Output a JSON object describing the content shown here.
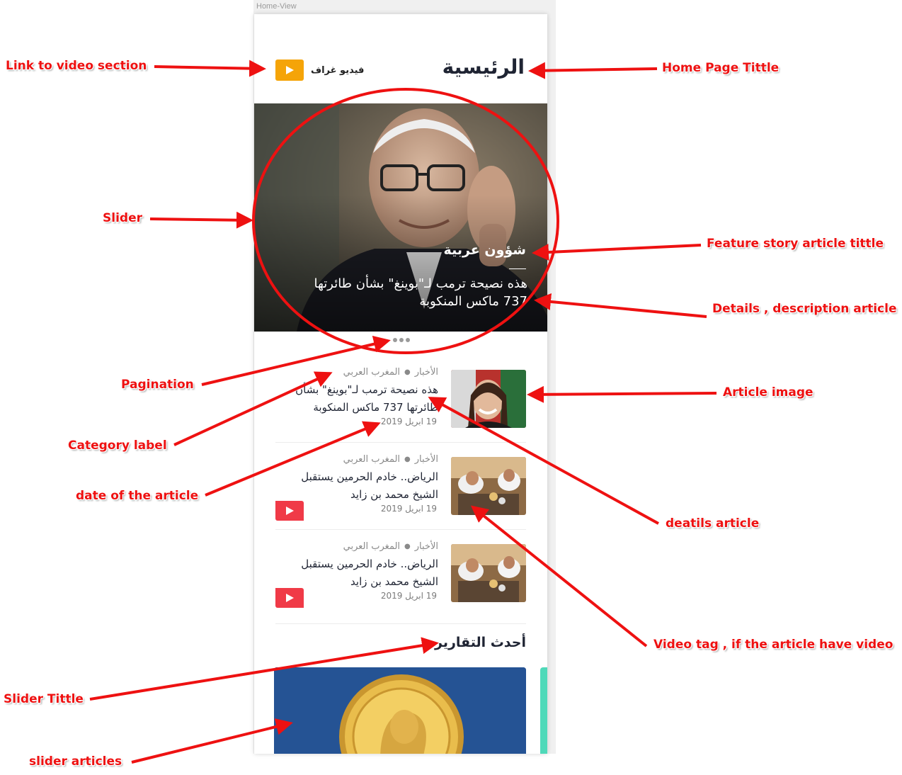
{
  "artboard_label": "Home-View",
  "header": {
    "title": "الرئيسية",
    "video_link_label": "فيديو غراف",
    "video_button_color": "#f5a408"
  },
  "slider": {
    "category": "شؤون عربية",
    "description": "هذه نصيحة ترمب لـ\"بوينغ\" بشأن طائرتها 737 ماكس المنكوبة",
    "pages": 3
  },
  "articles": [
    {
      "meta_section": "الأخبار",
      "meta_region": "المغرب العربي",
      "title": "هذه نصيحة ترمب لـ\"بوينغ\" بشأن طائرتها 737 ماكس المنكوبة",
      "date": "19 ابريل 2019",
      "has_video": false
    },
    {
      "meta_section": "الأخبار",
      "meta_region": "المغرب العربي",
      "title": "الرياض.. خادم الحرمين يستقبل الشيخ محمد بن زايد",
      "date": "19 ابريل 2019",
      "has_video": true
    },
    {
      "meta_section": "الأخبار",
      "meta_region": "المغرب العربي",
      "title": "الرياض.. خادم الحرمين يستقبل الشيخ محمد بن زايد",
      "date": "19 ابريل 2019",
      "has_video": true
    }
  ],
  "reports": {
    "title": "أحدث التقارير",
    "card_color": "#255394",
    "next_card_color": "#4fd9b9"
  },
  "annotations": {
    "link_video": "Link to video section",
    "home_title": "Home Page Tittle",
    "slider": "Slider",
    "feature_title": "Feature story article tittle",
    "details_desc": "Details , description article",
    "pagination": "Pagination",
    "article_image": "Article image",
    "category_label": "Category label",
    "date_article": "date of the article",
    "details_article": "deatils article",
    "video_tag": "Video tag , if the article have video",
    "slider_title": "Slider Tittle",
    "slider_articles": "slider articles",
    "color": "#ee1111"
  },
  "icons": {
    "play": "play-icon"
  }
}
